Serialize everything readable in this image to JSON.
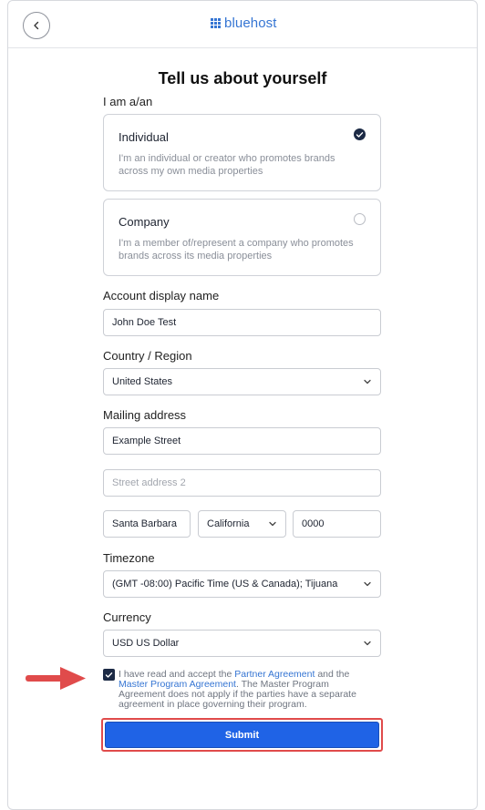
{
  "header": {
    "logo_text": "bluehost",
    "logo_color": "#3575d3"
  },
  "page_title": "Tell us about yourself",
  "entity": {
    "label": "I am a/an",
    "options": [
      {
        "title": "Individual",
        "description": "I'm an individual or creator who promotes brands across my own media properties",
        "selected": true
      },
      {
        "title": "Company",
        "description": "I'm a member of/represent a company who promotes brands across its media properties",
        "selected": false
      }
    ]
  },
  "account": {
    "label": "Account display name",
    "value": "John Doe Test"
  },
  "country": {
    "label": "Country / Region",
    "value": "United States"
  },
  "address": {
    "label": "Mailing address",
    "street": "Example Street",
    "street2_placeholder": "Street address 2",
    "city": "Santa Barbara",
    "state": "California",
    "zip": "0000"
  },
  "timezone": {
    "label": "Timezone",
    "value": "(GMT -08:00) Pacific Time (US & Canada); Tijuana"
  },
  "currency": {
    "label": "Currency",
    "value": "USD US Dollar"
  },
  "agreement": {
    "checked": true,
    "text_1": "I have read and accept the ",
    "link_1": "Partner Agreement",
    "text_2": " and the ",
    "link_2": "Master Program Agreement",
    "text_3": ". The Master Program Agreement does not apply if the parties have a separate agreement in place governing their program."
  },
  "submit_label": "Submit",
  "colors": {
    "primary": "#1f63e6",
    "highlight": "#e04b4b"
  }
}
